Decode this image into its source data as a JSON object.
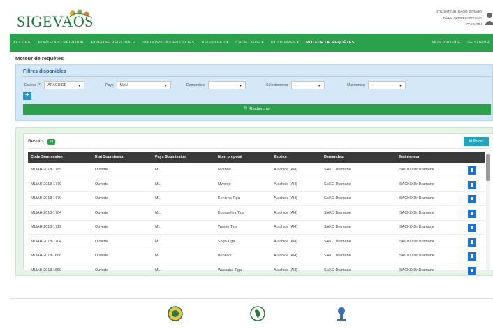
{
  "header": {
    "logo_text": "SIGEVAOS",
    "user_line": "UTILISATEUR: DAOO BERABO",
    "role_line": "RÔLE: ADMINISTRATEUR",
    "country_line": "PAYS: MLI"
  },
  "nav": {
    "items": [
      "ACCUEIL",
      "PORTFOLIO RÉGIONAL",
      "PIPELINE RÉGIONALE",
      "SOUMISSIONS EN COURS",
      "REGISTRES ▾",
      "CATALOGUE ▾",
      "UTILITAIRES ▾",
      "MOTEUR DE REQUÊTES"
    ],
    "right_items": [
      "MON PROFILE",
      "SE SORTIR"
    ]
  },
  "page_title": "Moteur de requêtes",
  "filters": {
    "title": "Filtres disponibles",
    "espece_label": "Espèce (*)",
    "espece_value": "ARACHIDE",
    "pays_label": "Pays",
    "pays_value": "MALI",
    "demandeur_label": "Demandeur",
    "demandeur_value": "...",
    "selectionneur_label": "Sélectionneur",
    "selectionneur_value": "...",
    "mainteneur_label": "Mainteneur",
    "mainteneur_value": "...",
    "add_label": "+",
    "search_label": "🔍 Rechercher"
  },
  "results": {
    "label": "Results",
    "count": "24",
    "export_label": "Export",
    "columns": [
      "Code Soumission",
      "Etat Soumission",
      "Pays Soumission",
      "Nom proposé",
      "Espèce",
      "Demandeur",
      "Mainteneur"
    ],
    "rows": [
      [
        "MLIAH-2018-1789",
        "Ouverte",
        "MLI",
        "Nyanda",
        "Arachide (AH)",
        "SAKO Dramane",
        "SACKO Dr Dramane"
      ],
      [
        "MLIAH-2018-1779",
        "Ouverte",
        "MLI",
        "Mwenje",
        "Arachide (AH)",
        "SAKO Dramane",
        "SACKO Dr Dramane"
      ],
      [
        "MLIAH-2018-1770",
        "Ouverte",
        "MLI",
        "Keniena Tiga",
        "Arachide (AH)",
        "SAKO Dramane",
        "SACKO Dr Dramane"
      ],
      [
        "MLIAH-2018-1764",
        "Ouverte",
        "MLI",
        "Kounzeliya Tiga",
        "Arachide (AH)",
        "SAKO Dramane",
        "SACKO Dr Dramane"
      ],
      [
        "MLIAH-2018-1719",
        "Ouverte",
        "MLI",
        "Wasso Tiga",
        "Arachide (AH)",
        "SAKO Dramane",
        "SACKO Dr Dramane"
      ],
      [
        "MLIAH-2018-1704",
        "Ouverte",
        "MLI",
        "Sogo Tiga",
        "Arachide (AH)",
        "SAKO Dramane",
        "SACKO Dr Dramane"
      ],
      [
        "MLIAH-2018-1666",
        "Ouverte",
        "MLI",
        "Benkadi",
        "Arachide (AH)",
        "SAKO Dramane",
        "SACKO Dr Dramane"
      ],
      [
        "MLIAH-2018-1650",
        "Ouverte",
        "MLI",
        "Wassaba Tiga",
        "Arachide (AH)",
        "SAKO Dramane",
        "SACKO Dr Dramane"
      ]
    ]
  },
  "colors": {
    "brand_green": "#2aa14a",
    "filter_blue": "#d4e8f7",
    "action_blue": "#1a73d9",
    "export_teal": "#21a5b8"
  },
  "icons": [
    "user-icon",
    "search-icon",
    "export-icon",
    "view-icon",
    "plus-icon"
  ]
}
